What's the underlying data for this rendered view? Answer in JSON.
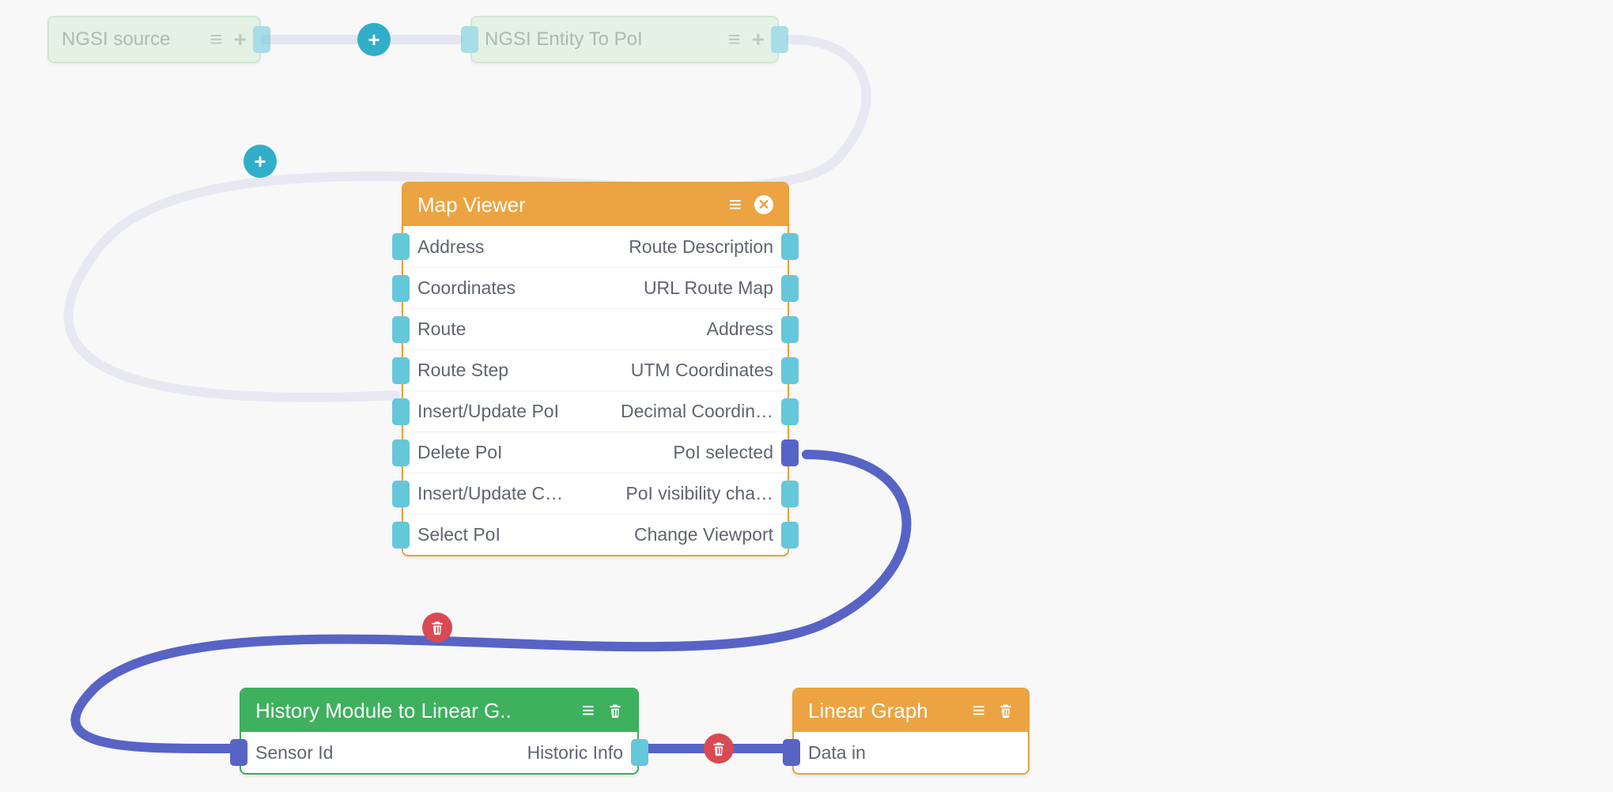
{
  "nodes": {
    "ngsi_source": {
      "title": "NGSI source"
    },
    "ngsi_entity_to_poi": {
      "title": "NGSI Entity To PoI"
    },
    "map_viewer": {
      "title": "Map Viewer",
      "inputs": [
        "Address",
        "Coordinates",
        "Route",
        "Route Step",
        "Insert/Update PoI",
        "Delete PoI",
        "Insert/Update C…",
        "Select PoI"
      ],
      "outputs": [
        "Route Description",
        "URL Route Map",
        "Address",
        "UTM Coordinates",
        "Decimal Coordin…",
        "PoI selected",
        "PoI visibility cha…",
        "Change Viewport"
      ]
    },
    "history_module": {
      "title": "History Module to Linear G..",
      "inputs": [
        "Sensor Id"
      ],
      "outputs": [
        "Historic Info"
      ]
    },
    "linear_graph": {
      "title": "Linear Graph",
      "inputs": [
        "Data in"
      ]
    }
  },
  "colors": {
    "teal": "#65c7da",
    "indigo": "#5863c6",
    "orange": "#eca442",
    "green": "#3eb05e",
    "red": "#d94a53",
    "faded_link": "#d8daed"
  }
}
